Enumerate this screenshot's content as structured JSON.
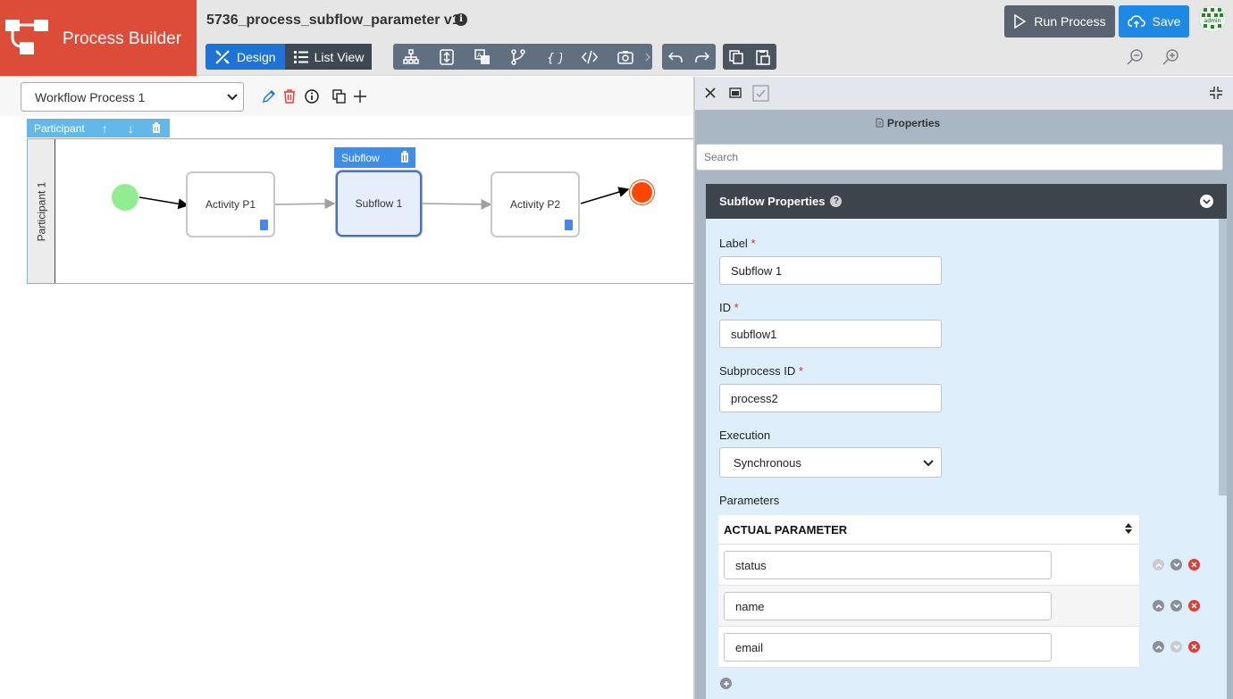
{
  "app": {
    "title": "Process Builder"
  },
  "header": {
    "process_title": "5736_process_subflow_parameter v1",
    "design_label": "Design",
    "list_view_label": "List View",
    "run_label": "Run Process",
    "save_label": "Save",
    "avatar_text": "admin",
    "tools": [
      "org-chart-icon",
      "swap-vertical-icon",
      "translate-icon",
      "branch-icon",
      "json-icon",
      "code-icon",
      "camera-icon"
    ],
    "colors": {
      "brand": "#dd4b39",
      "primary": "#1f73d6",
      "save": "#1e88e5"
    }
  },
  "canvas": {
    "workflow_select": "Workflow Process 1",
    "participant_tab": "Participant",
    "lane_label": "Participant 1",
    "nodes": {
      "activity1": "Activity P1",
      "subflow": "Subflow 1",
      "activity2": "Activity P2"
    },
    "subflow_tag": "Subflow"
  },
  "panel": {
    "title": "Properties",
    "search_placeholder": "Search",
    "section_title": "Subflow Properties",
    "fields": {
      "label_label": "Label",
      "label_value": "Subflow 1",
      "id_label": "ID",
      "id_value": "subflow1",
      "subprocess_label": "Subprocess ID",
      "subprocess_value": "process2",
      "execution_label": "Execution",
      "execution_value": "Synchronous",
      "parameters_label": "Parameters"
    },
    "param_header": "ACTUAL PARAMETER",
    "params": [
      "status",
      "name",
      "email"
    ],
    "required_mark": "*"
  }
}
